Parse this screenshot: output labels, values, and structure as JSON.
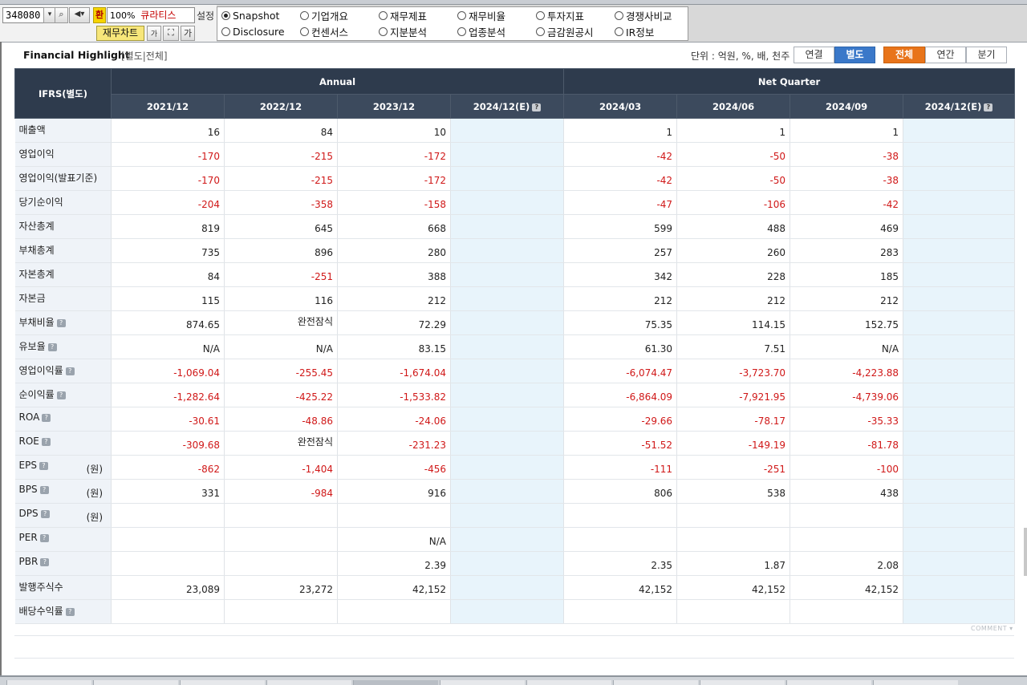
{
  "toolbar": {
    "stock_code": "348080",
    "currency_icon_label": "환",
    "zoom": "100%",
    "company_name": "큐라티스",
    "settings_label": "설정",
    "fin_chart_label": "재무차트",
    "font_small_label": "가",
    "font_large_label": "가"
  },
  "menu": {
    "items": [
      {
        "label": "Snapshot",
        "selected": true
      },
      {
        "label": "기업개요",
        "selected": false
      },
      {
        "label": "재무제표",
        "selected": false
      },
      {
        "label": "재무비율",
        "selected": false
      },
      {
        "label": "투자지표",
        "selected": false
      },
      {
        "label": "경쟁사비교",
        "selected": false
      },
      {
        "label": "Disclosure",
        "selected": false
      },
      {
        "label": "컨센서스",
        "selected": false
      },
      {
        "label": "지분분석",
        "selected": false
      },
      {
        "label": "업종분석",
        "selected": false
      },
      {
        "label": "금감원공시",
        "selected": false
      },
      {
        "label": "IR정보",
        "selected": false
      }
    ]
  },
  "section": {
    "title": "Financial Highlight",
    "subtitle": "[별도|전체]",
    "unit_label": "단위 : 억원, %, 배, 천주",
    "toggle_consolidated": "연결",
    "toggle_separate": "별도",
    "period_all": "전체",
    "period_annual": "연간",
    "period_quarter": "분기"
  },
  "table": {
    "corner_label": "IFRS(별도)",
    "group_annual": "Annual",
    "group_quarter": "Net Quarter",
    "columns": [
      "2021/12",
      "2022/12",
      "2023/12",
      "2024/12(E)",
      "2024/03",
      "2024/06",
      "2024/09",
      "2024/12(E)"
    ],
    "rows": [
      {
        "label": "매출액",
        "unit": "",
        "help": false,
        "values": [
          "16",
          "84",
          "10",
          "",
          "1",
          "1",
          "1",
          ""
        ]
      },
      {
        "label": "영업이익",
        "unit": "",
        "help": false,
        "values": [
          "-170",
          "-215",
          "-172",
          "",
          "-42",
          "-50",
          "-38",
          ""
        ]
      },
      {
        "label": "영업이익(발표기준)",
        "unit": "",
        "help": false,
        "values": [
          "-170",
          "-215",
          "-172",
          "",
          "-42",
          "-50",
          "-38",
          ""
        ]
      },
      {
        "label": "당기순이익",
        "unit": "",
        "help": false,
        "values": [
          "-204",
          "-358",
          "-158",
          "",
          "-47",
          "-106",
          "-42",
          ""
        ]
      },
      {
        "label": "자산총계",
        "unit": "",
        "help": false,
        "values": [
          "819",
          "645",
          "668",
          "",
          "599",
          "488",
          "469",
          ""
        ]
      },
      {
        "label": "부채총계",
        "unit": "",
        "help": false,
        "values": [
          "735",
          "896",
          "280",
          "",
          "257",
          "260",
          "283",
          ""
        ]
      },
      {
        "label": "자본총계",
        "unit": "",
        "help": false,
        "values": [
          "84",
          "-251",
          "388",
          "",
          "342",
          "228",
          "185",
          ""
        ]
      },
      {
        "label": "자본금",
        "unit": "",
        "help": false,
        "values": [
          "115",
          "116",
          "212",
          "",
          "212",
          "212",
          "212",
          ""
        ]
      },
      {
        "label": "부채비율",
        "unit": "",
        "help": true,
        "values": [
          "874.65",
          "완전잠식",
          "72.29",
          "",
          "75.35",
          "114.15",
          "152.75",
          ""
        ]
      },
      {
        "label": "유보율",
        "unit": "",
        "help": true,
        "values": [
          "N/A",
          "N/A",
          "83.15",
          "",
          "61.30",
          "7.51",
          "N/A",
          ""
        ]
      },
      {
        "label": "영업이익률",
        "unit": "",
        "help": true,
        "values": [
          "-1,069.04",
          "-255.45",
          "-1,674.04",
          "",
          "-6,074.47",
          "-3,723.70",
          "-4,223.88",
          ""
        ]
      },
      {
        "label": "순이익률",
        "unit": "",
        "help": true,
        "values": [
          "-1,282.64",
          "-425.22",
          "-1,533.82",
          "",
          "-6,864.09",
          "-7,921.95",
          "-4,739.06",
          ""
        ]
      },
      {
        "label": "ROA",
        "unit": "",
        "help": true,
        "values": [
          "-30.61",
          "-48.86",
          "-24.06",
          "",
          "-29.66",
          "-78.17",
          "-35.33",
          ""
        ]
      },
      {
        "label": "ROE",
        "unit": "",
        "help": true,
        "values": [
          "-309.68",
          "완전잠식",
          "-231.23",
          "",
          "-51.52",
          "-149.19",
          "-81.78",
          ""
        ]
      },
      {
        "label": "EPS",
        "unit": "(원)",
        "help": true,
        "values": [
          "-862",
          "-1,404",
          "-456",
          "",
          "-111",
          "-251",
          "-100",
          ""
        ]
      },
      {
        "label": "BPS",
        "unit": "(원)",
        "help": true,
        "values": [
          "331",
          "-984",
          "916",
          "",
          "806",
          "538",
          "438",
          ""
        ]
      },
      {
        "label": "DPS",
        "unit": "(원)",
        "help": true,
        "values": [
          "",
          "",
          "",
          "",
          "",
          "",
          "",
          ""
        ]
      },
      {
        "label": "PER",
        "unit": "",
        "help": true,
        "values": [
          "",
          "",
          "N/A",
          "",
          "",
          "",
          "",
          ""
        ]
      },
      {
        "label": "PBR",
        "unit": "",
        "help": true,
        "values": [
          "",
          "",
          "2.39",
          "",
          "2.35",
          "1.87",
          "2.08",
          ""
        ]
      },
      {
        "label": "발행주식수",
        "unit": "",
        "help": false,
        "values": [
          "23,089",
          "23,272",
          "42,152",
          "",
          "42,152",
          "42,152",
          "42,152",
          ""
        ]
      },
      {
        "label": "배당수익률",
        "unit": "",
        "help": true,
        "values": [
          "",
          "",
          "",
          "",
          "",
          "",
          "",
          ""
        ]
      }
    ]
  },
  "footer": {
    "comment_label": "COMMENT"
  },
  "colors": {
    "header_dark": "#2e3b4d",
    "negative": "#d01818",
    "estimate_bg": "#e8f4fb",
    "label_bg": "#eff3f8",
    "accent_blue": "#3a78c9",
    "accent_orange": "#e8741a"
  }
}
